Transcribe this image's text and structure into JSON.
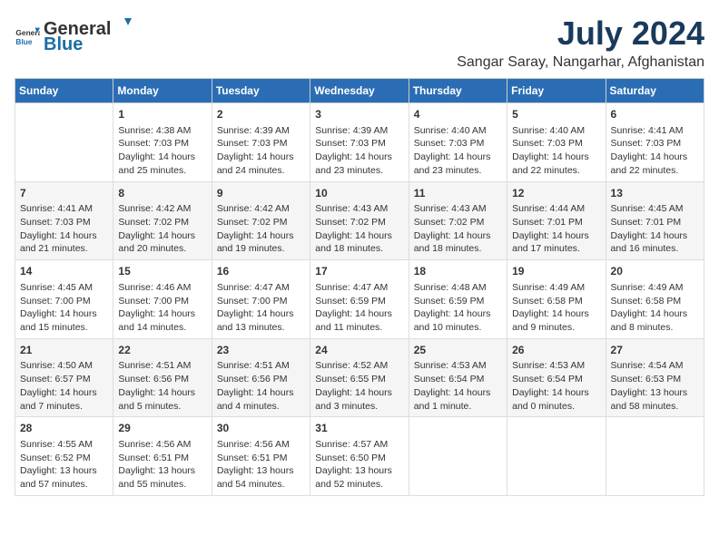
{
  "logo": {
    "text_general": "General",
    "text_blue": "Blue"
  },
  "title": "July 2024",
  "subtitle": "Sangar Saray, Nangarhar, Afghanistan",
  "weekdays": [
    "Sunday",
    "Monday",
    "Tuesday",
    "Wednesday",
    "Thursday",
    "Friday",
    "Saturday"
  ],
  "weeks": [
    [
      {
        "day": "",
        "info": ""
      },
      {
        "day": "1",
        "info": "Sunrise: 4:38 AM\nSunset: 7:03 PM\nDaylight: 14 hours\nand 25 minutes."
      },
      {
        "day": "2",
        "info": "Sunrise: 4:39 AM\nSunset: 7:03 PM\nDaylight: 14 hours\nand 24 minutes."
      },
      {
        "day": "3",
        "info": "Sunrise: 4:39 AM\nSunset: 7:03 PM\nDaylight: 14 hours\nand 23 minutes."
      },
      {
        "day": "4",
        "info": "Sunrise: 4:40 AM\nSunset: 7:03 PM\nDaylight: 14 hours\nand 23 minutes."
      },
      {
        "day": "5",
        "info": "Sunrise: 4:40 AM\nSunset: 7:03 PM\nDaylight: 14 hours\nand 22 minutes."
      },
      {
        "day": "6",
        "info": "Sunrise: 4:41 AM\nSunset: 7:03 PM\nDaylight: 14 hours\nand 22 minutes."
      }
    ],
    [
      {
        "day": "7",
        "info": "Sunrise: 4:41 AM\nSunset: 7:03 PM\nDaylight: 14 hours\nand 21 minutes."
      },
      {
        "day": "8",
        "info": "Sunrise: 4:42 AM\nSunset: 7:02 PM\nDaylight: 14 hours\nand 20 minutes."
      },
      {
        "day": "9",
        "info": "Sunrise: 4:42 AM\nSunset: 7:02 PM\nDaylight: 14 hours\nand 19 minutes."
      },
      {
        "day": "10",
        "info": "Sunrise: 4:43 AM\nSunset: 7:02 PM\nDaylight: 14 hours\nand 18 minutes."
      },
      {
        "day": "11",
        "info": "Sunrise: 4:43 AM\nSunset: 7:02 PM\nDaylight: 14 hours\nand 18 minutes."
      },
      {
        "day": "12",
        "info": "Sunrise: 4:44 AM\nSunset: 7:01 PM\nDaylight: 14 hours\nand 17 minutes."
      },
      {
        "day": "13",
        "info": "Sunrise: 4:45 AM\nSunset: 7:01 PM\nDaylight: 14 hours\nand 16 minutes."
      }
    ],
    [
      {
        "day": "14",
        "info": "Sunrise: 4:45 AM\nSunset: 7:00 PM\nDaylight: 14 hours\nand 15 minutes."
      },
      {
        "day": "15",
        "info": "Sunrise: 4:46 AM\nSunset: 7:00 PM\nDaylight: 14 hours\nand 14 minutes."
      },
      {
        "day": "16",
        "info": "Sunrise: 4:47 AM\nSunset: 7:00 PM\nDaylight: 14 hours\nand 13 minutes."
      },
      {
        "day": "17",
        "info": "Sunrise: 4:47 AM\nSunset: 6:59 PM\nDaylight: 14 hours\nand 11 minutes."
      },
      {
        "day": "18",
        "info": "Sunrise: 4:48 AM\nSunset: 6:59 PM\nDaylight: 14 hours\nand 10 minutes."
      },
      {
        "day": "19",
        "info": "Sunrise: 4:49 AM\nSunset: 6:58 PM\nDaylight: 14 hours\nand 9 minutes."
      },
      {
        "day": "20",
        "info": "Sunrise: 4:49 AM\nSunset: 6:58 PM\nDaylight: 14 hours\nand 8 minutes."
      }
    ],
    [
      {
        "day": "21",
        "info": "Sunrise: 4:50 AM\nSunset: 6:57 PM\nDaylight: 14 hours\nand 7 minutes."
      },
      {
        "day": "22",
        "info": "Sunrise: 4:51 AM\nSunset: 6:56 PM\nDaylight: 14 hours\nand 5 minutes."
      },
      {
        "day": "23",
        "info": "Sunrise: 4:51 AM\nSunset: 6:56 PM\nDaylight: 14 hours\nand 4 minutes."
      },
      {
        "day": "24",
        "info": "Sunrise: 4:52 AM\nSunset: 6:55 PM\nDaylight: 14 hours\nand 3 minutes."
      },
      {
        "day": "25",
        "info": "Sunrise: 4:53 AM\nSunset: 6:54 PM\nDaylight: 14 hours\nand 1 minute."
      },
      {
        "day": "26",
        "info": "Sunrise: 4:53 AM\nSunset: 6:54 PM\nDaylight: 14 hours\nand 0 minutes."
      },
      {
        "day": "27",
        "info": "Sunrise: 4:54 AM\nSunset: 6:53 PM\nDaylight: 13 hours\nand 58 minutes."
      }
    ],
    [
      {
        "day": "28",
        "info": "Sunrise: 4:55 AM\nSunset: 6:52 PM\nDaylight: 13 hours\nand 57 minutes."
      },
      {
        "day": "29",
        "info": "Sunrise: 4:56 AM\nSunset: 6:51 PM\nDaylight: 13 hours\nand 55 minutes."
      },
      {
        "day": "30",
        "info": "Sunrise: 4:56 AM\nSunset: 6:51 PM\nDaylight: 13 hours\nand 54 minutes."
      },
      {
        "day": "31",
        "info": "Sunrise: 4:57 AM\nSunset: 6:50 PM\nDaylight: 13 hours\nand 52 minutes."
      },
      {
        "day": "",
        "info": ""
      },
      {
        "day": "",
        "info": ""
      },
      {
        "day": "",
        "info": ""
      }
    ]
  ]
}
